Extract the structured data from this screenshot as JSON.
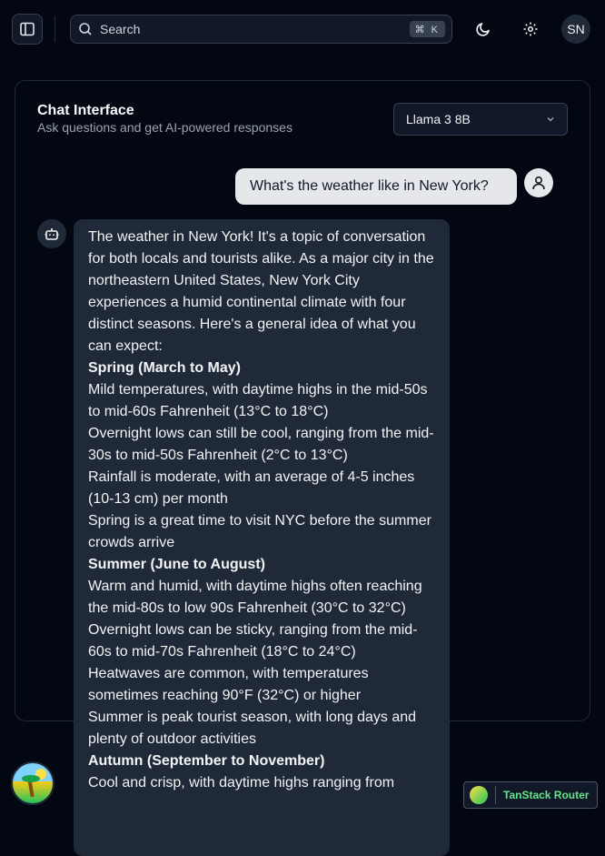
{
  "topbar": {
    "search_placeholder": "Search",
    "search_shortcut": "⌘ K",
    "avatar_initials": "SN"
  },
  "chat": {
    "title": "Chat Interface",
    "subtitle": "Ask questions and get AI-powered responses",
    "model": "Llama 3 8B",
    "user_message": "What's the weather like in New York?",
    "assistant_paragraphs": [
      "The weather in New York! It's a topic of conversation for both locals and tourists alike. As a major city in the northeastern United States, New York City experiences a humid continental climate with four distinct seasons. Here's a general idea of what you can expect:",
      "Spring (March to May)",
      "Mild temperatures, with daytime highs in the mid-50s to mid-60s Fahrenheit (13°C to 18°C)",
      "Overnight lows can still be cool, ranging from the mid-30s to mid-50s Fahrenheit (2°C to 13°C)",
      "Rainfall is moderate, with an average of 4-5 inches (10-13 cm) per month",
      "Spring is a great time to visit NYC before the summer crowds arrive",
      "Summer (June to August)",
      "Warm and humid, with daytime highs often reaching the mid-80s to low 90s Fahrenheit (30°C to 32°C)",
      "Overnight lows can be sticky, ranging from the mid-60s to mid-70s Fahrenheit (18°C to 24°C)",
      "Heatwaves are common, with temperatures sometimes reaching 90°F (32°C) or higher",
      "Summer is peak tourist season, with long days and plenty of outdoor activities",
      "Autumn (September to November)",
      "Cool and crisp, with daytime highs ranging from"
    ]
  },
  "footer": {
    "router_label": "TanStack Router"
  },
  "icons": {
    "sidebar": "sidebar-toggle-icon",
    "search": "search-icon",
    "theme": "moon-icon",
    "settings": "gear-icon",
    "user": "user-icon",
    "bot": "bot-icon",
    "chevron": "chevron-down-icon"
  }
}
